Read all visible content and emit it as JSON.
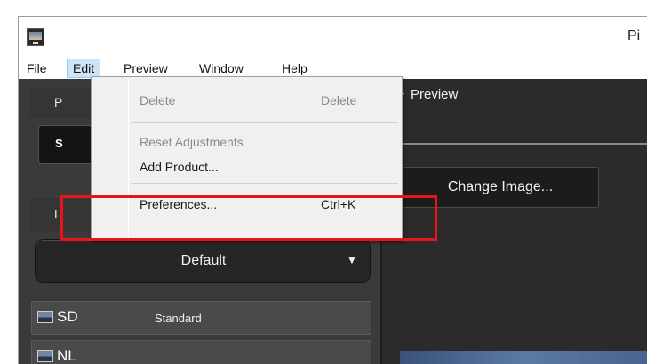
{
  "window": {
    "title": "Pi"
  },
  "menubar": {
    "items": [
      {
        "label": "File"
      },
      {
        "label": "Edit",
        "active": true
      },
      {
        "label": "Preview"
      },
      {
        "label": "Window"
      },
      {
        "label": "Help"
      }
    ]
  },
  "edit_menu": {
    "items": [
      {
        "label": "Delete",
        "shortcut": "Delete",
        "enabled": false
      },
      {
        "label": "Reset Adjustments",
        "shortcut": "",
        "enabled": false
      },
      {
        "label": "Add Product...",
        "shortcut": "",
        "enabled": true
      },
      {
        "label": "Preferences...",
        "shortcut": "Ctrl+K",
        "enabled": true
      }
    ]
  },
  "left_panel": {
    "header_p_letter": "P",
    "selection_letter": "S",
    "header_l_letter": "L",
    "dropdown": {
      "label": "Default",
      "arrow_icon": "triangle-down-icon"
    },
    "picture_controls": [
      {
        "code": "SD",
        "name": "Standard"
      },
      {
        "code": "NL",
        "name": ""
      }
    ]
  },
  "preview_panel": {
    "title": "Preview",
    "change_image_button": "Change Image..."
  },
  "colors": {
    "highlight": "#e8141c",
    "menu_active": "#cce4f7",
    "panel_dark": "#2b2b2b"
  }
}
